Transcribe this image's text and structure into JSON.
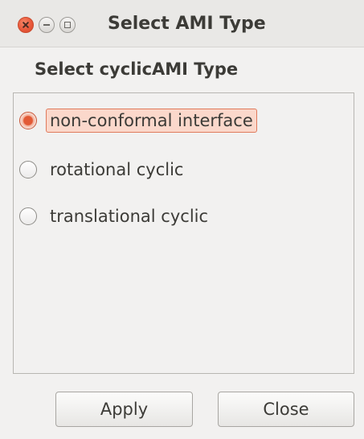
{
  "window": {
    "title": "Select AMI Type",
    "controls": [
      "close-icon",
      "minimize-icon",
      "maximize-icon"
    ]
  },
  "group": {
    "title": "Select cyclicAMI Type",
    "options": [
      {
        "label": "non-conformal interface",
        "checked": true
      },
      {
        "label": "rotational cyclic",
        "checked": false
      },
      {
        "label": "translational cyclic",
        "checked": false
      }
    ]
  },
  "buttons": {
    "apply_label": "Apply",
    "close_label": "Close"
  },
  "colors": {
    "accent": "#e25a36",
    "focus_bg": "#fbd8cb",
    "text": "#3c3b37"
  }
}
